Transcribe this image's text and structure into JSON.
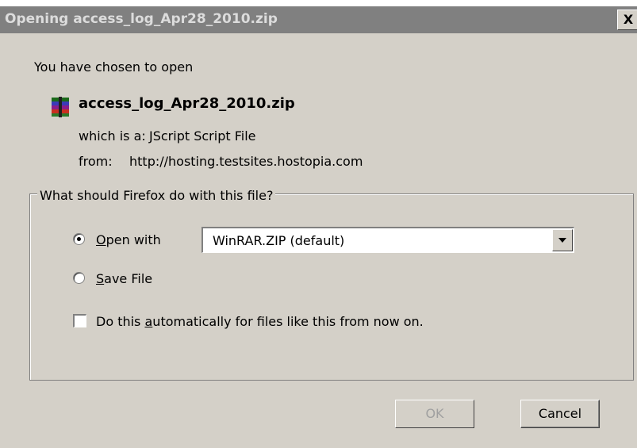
{
  "window": {
    "title": "Opening access_log_Apr28_2010.zip",
    "close_label": "X"
  },
  "dialog": {
    "intro": "You have chosen to open",
    "file_name": "access_log_Apr28_2010.zip",
    "type_label": "which is a:",
    "type_value": "JScript Script File",
    "from_label": "from:",
    "from_value": "http://hosting.testsites.hostopia.com",
    "file_icon": "winrar-archive-icon"
  },
  "action_group": {
    "legend": "What should Firefox do with this file?",
    "open_with": {
      "prefix": "",
      "accel": "O",
      "rest": "pen with",
      "selected": true
    },
    "app_select": {
      "value": "WinRAR.ZIP (default)"
    },
    "save_file": {
      "accel": "S",
      "rest": "ave File",
      "selected": false
    },
    "auto_checkbox": {
      "pre": "Do this ",
      "accel": "a",
      "rest": "utomatically for files like this from now on.",
      "checked": false
    }
  },
  "buttons": {
    "ok": "OK",
    "cancel": "Cancel"
  }
}
